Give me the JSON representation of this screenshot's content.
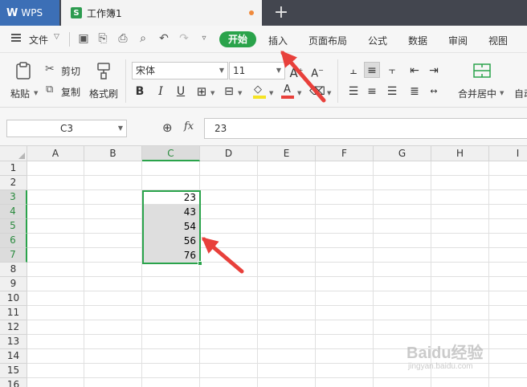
{
  "app": {
    "wps_label": "WPS",
    "doc_tab_title": "工作簿1",
    "new_tab_symbol": "+"
  },
  "menubar": {
    "file_label": "文件",
    "tabs": [
      "开始",
      "插入",
      "页面布局",
      "公式",
      "数据",
      "审阅",
      "视图"
    ]
  },
  "ribbon": {
    "paste_label": "粘贴",
    "cut_label": "剪切",
    "copy_label": "复制",
    "format_painter_label": "格式刷",
    "font_name": "宋体",
    "font_size": "11",
    "merge_center_label": "合并居中",
    "auto_wrap_label": "自动"
  },
  "formula_bar": {
    "name_box": "C3",
    "fx_label": "fx",
    "formula_value": "23"
  },
  "grid": {
    "columns": [
      "A",
      "B",
      "C",
      "D",
      "E",
      "F",
      "G",
      "H",
      "I"
    ],
    "rows": [
      "1",
      "2",
      "3",
      "4",
      "5",
      "6",
      "7",
      "8",
      "9",
      "10",
      "11",
      "12",
      "13",
      "14",
      "15",
      "16"
    ],
    "selected_column": "C",
    "selected_rows": [
      "3",
      "4",
      "5",
      "6",
      "7"
    ],
    "cells": [
      {
        "ref": "C3",
        "value": "23"
      },
      {
        "ref": "C4",
        "value": "43"
      },
      {
        "ref": "C5",
        "value": "54"
      },
      {
        "ref": "C6",
        "value": "56"
      },
      {
        "ref": "C7",
        "value": "76"
      }
    ]
  },
  "watermark": {
    "text": "Baidu经验",
    "sub": "jingyan.baidu.com"
  },
  "colors": {
    "accent_green": "#2aa34b",
    "annotation_red": "#e8403b",
    "wps_blue": "#3c6fb6"
  }
}
